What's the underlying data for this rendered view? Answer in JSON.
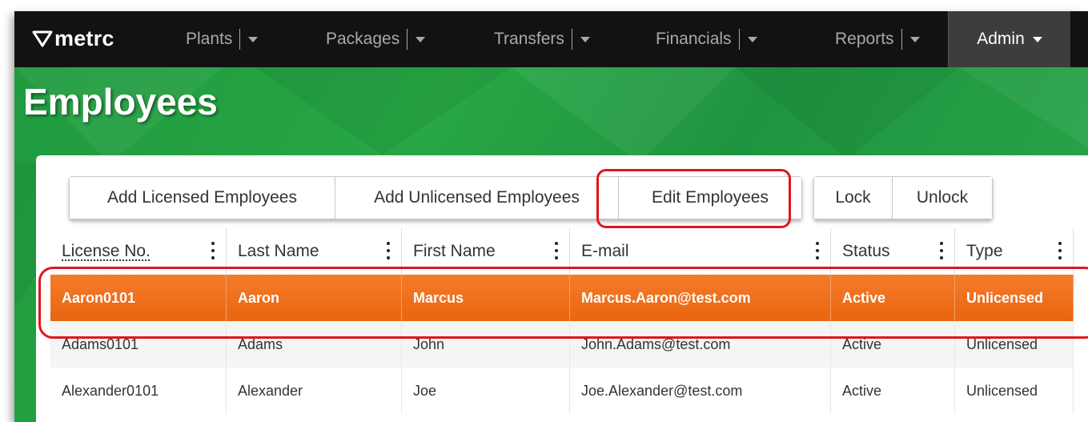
{
  "navbar": {
    "logo_text": "metrc",
    "items": [
      {
        "label": "Plants"
      },
      {
        "label": "Packages"
      },
      {
        "label": "Transfers"
      },
      {
        "label": "Financials"
      },
      {
        "label": "Reports"
      }
    ],
    "admin_label": "Admin"
  },
  "page": {
    "title": "Employees"
  },
  "toolbar": {
    "group1": [
      "Add Licensed Employees",
      "Add Unlicensed Employees",
      "Edit Employees"
    ],
    "group2": [
      "Lock",
      "Unlock"
    ]
  },
  "table": {
    "columns": [
      "License No.",
      "Last Name",
      "First Name",
      "E-mail",
      "Status",
      "Type"
    ],
    "rows": [
      [
        "Aaron0101",
        "Aaron",
        "Marcus",
        "Marcus.Aaron@test.com",
        "Active",
        "Unlicensed"
      ],
      [
        "Adams0101",
        "Adams",
        "John",
        "John.Adams@test.com",
        "Active",
        "Unlicensed"
      ],
      [
        "Alexander0101",
        "Alexander",
        "Joe",
        "Joe.Alexander@test.com",
        "Active",
        "Unlicensed"
      ]
    ],
    "selected_row": 0
  },
  "colors": {
    "navbar_bg": "#121212",
    "banner_green": "#28a745",
    "selected_row": "#f07020",
    "annotation_red": "#e0161a"
  }
}
